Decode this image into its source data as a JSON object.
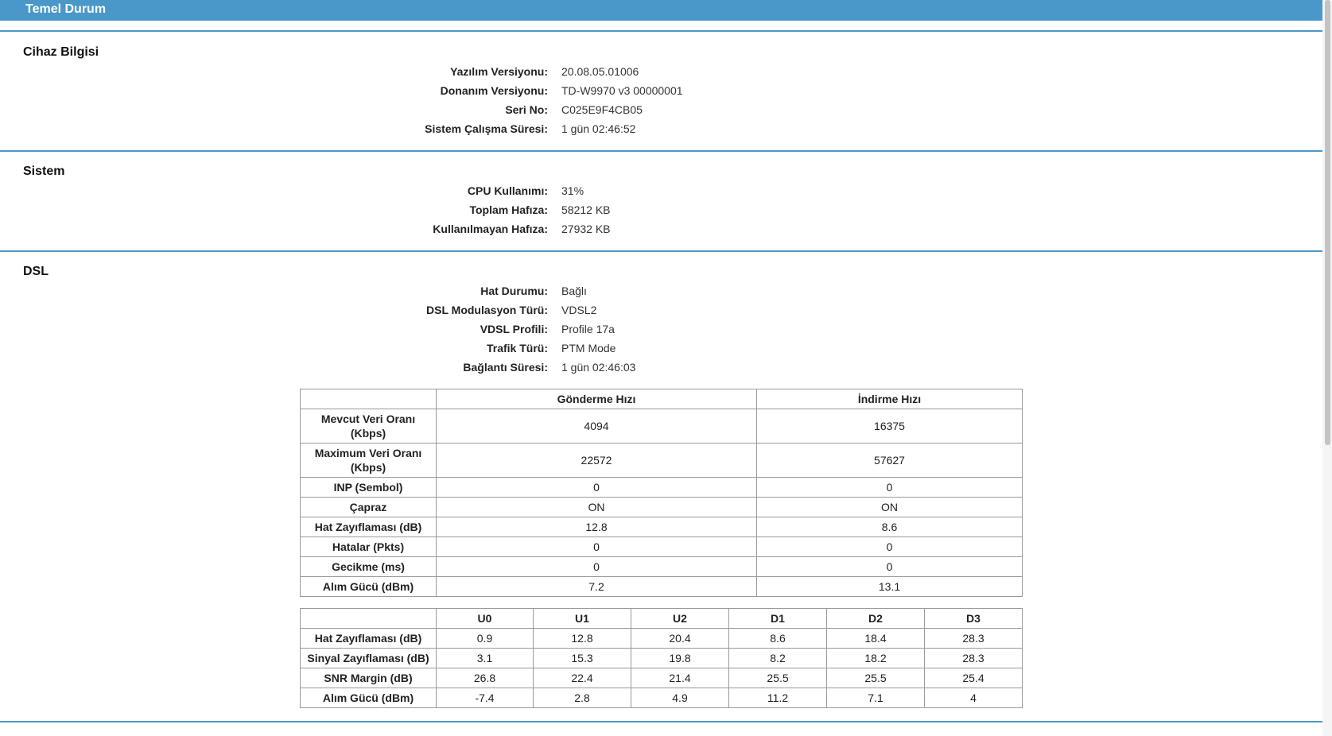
{
  "header": {
    "title": "Temel Durum"
  },
  "device_info": {
    "title": "Cihaz Bilgisi",
    "rows": [
      {
        "label": "Yazılım Versiyonu:",
        "value": "20.08.05.01006"
      },
      {
        "label": "Donanım Versiyonu:",
        "value": "TD-W9970 v3 00000001"
      },
      {
        "label": "Seri No:",
        "value": "C025E9F4CB05"
      },
      {
        "label": "Sistem Çalışma Süresi:",
        "value": "1 gün 02:46:52"
      }
    ]
  },
  "system": {
    "title": "Sistem",
    "rows": [
      {
        "label": "CPU Kullanımı:",
        "value": "31%"
      },
      {
        "label": "Toplam Hafıza:",
        "value": "58212 KB"
      },
      {
        "label": "Kullanılmayan Hafıza:",
        "value": "27932 KB"
      }
    ]
  },
  "dsl": {
    "title": "DSL",
    "rows": [
      {
        "label": "Hat Durumu:",
        "value": "Bağlı"
      },
      {
        "label": "DSL Modulasyon Türü:",
        "value": "VDSL2"
      },
      {
        "label": "VDSL Profili:",
        "value": "Profile 17a"
      },
      {
        "label": "Trafik Türü:",
        "value": "PTM Mode"
      },
      {
        "label": "Bağlantı Süresi:",
        "value": "1 gün 02:46:03"
      }
    ],
    "rate_table": {
      "headers": [
        "",
        "Gönderme Hızı",
        "İndirme Hızı"
      ],
      "rows": [
        {
          "label": "Mevcut Veri Oranı (Kbps)",
          "up": "4094",
          "down": "16375"
        },
        {
          "label": "Maximum Veri Oranı (Kbps)",
          "up": "22572",
          "down": "57627"
        },
        {
          "label": "INP (Sembol)",
          "up": "0",
          "down": "0"
        },
        {
          "label": "Çapraz",
          "up": "ON",
          "down": "ON"
        },
        {
          "label": "Hat Zayıflaması (dB)",
          "up": "12.8",
          "down": "8.6"
        },
        {
          "label": "Hatalar (Pkts)",
          "up": "0",
          "down": "0"
        },
        {
          "label": "Gecikme (ms)",
          "up": "0",
          "down": "0"
        },
        {
          "label": "Alım Gücü (dBm)",
          "up": "7.2",
          "down": "13.1"
        }
      ]
    },
    "band_table": {
      "headers": [
        "",
        "U0",
        "U1",
        "U2",
        "D1",
        "D2",
        "D3"
      ],
      "rows": [
        {
          "label": "Hat Zayıflaması (dB)",
          "values": [
            "0.9",
            "12.8",
            "20.4",
            "8.6",
            "18.4",
            "28.3"
          ]
        },
        {
          "label": "Sinyal Zayıflaması (dB)",
          "values": [
            "3.1",
            "15.3",
            "19.8",
            "8.2",
            "18.2",
            "28.3"
          ]
        },
        {
          "label": "SNR Margin (dB)",
          "values": [
            "26.8",
            "22.4",
            "21.4",
            "25.5",
            "25.5",
            "25.4"
          ]
        },
        {
          "label": "Alım Gücü (dBm)",
          "values": [
            "-7.4",
            "2.8",
            "4.9",
            "11.2",
            "7.1",
            "4"
          ]
        }
      ]
    }
  }
}
